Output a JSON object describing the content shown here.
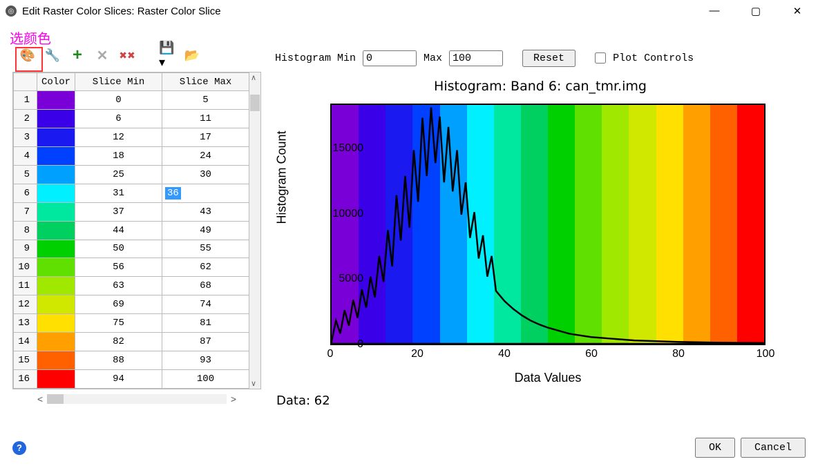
{
  "window": {
    "title": "Edit Raster Color Slices: Raster Color Slice"
  },
  "annotation": "选颜色",
  "toolbar": {
    "picker": "color-picker-icon",
    "colormap": "colormap-icon",
    "add": "add-icon",
    "delete": "delete-icon",
    "delete_all": "delete-all-icon",
    "save": "save-icon",
    "open": "open-icon"
  },
  "histogram_controls": {
    "min_label": "Histogram Min",
    "min_value": "0",
    "max_label": "Max",
    "max_value": "100",
    "reset_label": "Reset",
    "plot_controls_label": "Plot Controls"
  },
  "table": {
    "headers": [
      "Color",
      "Slice Min",
      "Slice Max"
    ],
    "rows": [
      {
        "n": 1,
        "color": "#7a00d8",
        "min": "0",
        "max": "5"
      },
      {
        "n": 2,
        "color": "#3a00e8",
        "min": "6",
        "max": "11"
      },
      {
        "n": 3,
        "color": "#1a1af0",
        "min": "12",
        "max": "17"
      },
      {
        "n": 4,
        "color": "#0040ff",
        "min": "18",
        "max": "24"
      },
      {
        "n": 5,
        "color": "#00a0ff",
        "min": "25",
        "max": "30"
      },
      {
        "n": 6,
        "color": "#00f0ff",
        "min": "31",
        "max": "36",
        "editing": true
      },
      {
        "n": 7,
        "color": "#00e8a0",
        "min": "37",
        "max": "43"
      },
      {
        "n": 8,
        "color": "#00d060",
        "min": "44",
        "max": "49"
      },
      {
        "n": 9,
        "color": "#00d000",
        "min": "50",
        "max": "55"
      },
      {
        "n": 10,
        "color": "#60e000",
        "min": "56",
        "max": "62"
      },
      {
        "n": 11,
        "color": "#a0e800",
        "min": "63",
        "max": "68"
      },
      {
        "n": 12,
        "color": "#d0e800",
        "min": "69",
        "max": "74"
      },
      {
        "n": 13,
        "color": "#ffe000",
        "min": "75",
        "max": "81"
      },
      {
        "n": 14,
        "color": "#ffa000",
        "min": "82",
        "max": "87"
      },
      {
        "n": 15,
        "color": "#ff6000",
        "min": "88",
        "max": "93"
      },
      {
        "n": 16,
        "color": "#ff0000",
        "min": "94",
        "max": "100"
      }
    ]
  },
  "chart_data": {
    "type": "area",
    "title": "Histogram: Band 6: can_tmr.img",
    "xlabel": "Data Values",
    "ylabel": "Histogram Count",
    "xlim": [
      0,
      100
    ],
    "ylim": [
      0,
      18500
    ],
    "xticks": [
      0,
      20,
      40,
      60,
      80,
      100
    ],
    "yticks": [
      0,
      5000,
      10000,
      15000
    ],
    "background_stripes": [
      "#7a00d8",
      "#3a00e8",
      "#1a1af0",
      "#0040ff",
      "#00a0ff",
      "#00f0ff",
      "#00e8a0",
      "#00d060",
      "#00d000",
      "#60e000",
      "#a0e800",
      "#d0e800",
      "#ffe000",
      "#ffa000",
      "#ff6000",
      "#ff0000"
    ],
    "series": [
      {
        "name": "histogram",
        "x": [
          0,
          1,
          2,
          3,
          4,
          5,
          6,
          7,
          8,
          9,
          10,
          11,
          12,
          13,
          14,
          15,
          16,
          17,
          18,
          19,
          20,
          21,
          22,
          23,
          24,
          25,
          26,
          27,
          28,
          29,
          30,
          31,
          32,
          33,
          34,
          35,
          36,
          37,
          38,
          40,
          42,
          44,
          46,
          48,
          50,
          55,
          60,
          70,
          80,
          90,
          100
        ],
        "y": [
          200,
          1800,
          800,
          2600,
          1400,
          3400,
          2000,
          4200,
          2800,
          5200,
          3600,
          6800,
          4800,
          8800,
          6000,
          11500,
          8000,
          13000,
          9000,
          15000,
          11000,
          17500,
          13000,
          18300,
          14000,
          17600,
          12500,
          16800,
          11800,
          15000,
          10000,
          12500,
          8200,
          10200,
          6600,
          8400,
          5200,
          6800,
          4100,
          3300,
          2700,
          2200,
          1800,
          1500,
          1250,
          780,
          520,
          260,
          150,
          90,
          60
        ]
      }
    ],
    "readout": "Data: 62"
  },
  "buttons": {
    "ok": "OK",
    "cancel": "Cancel"
  }
}
